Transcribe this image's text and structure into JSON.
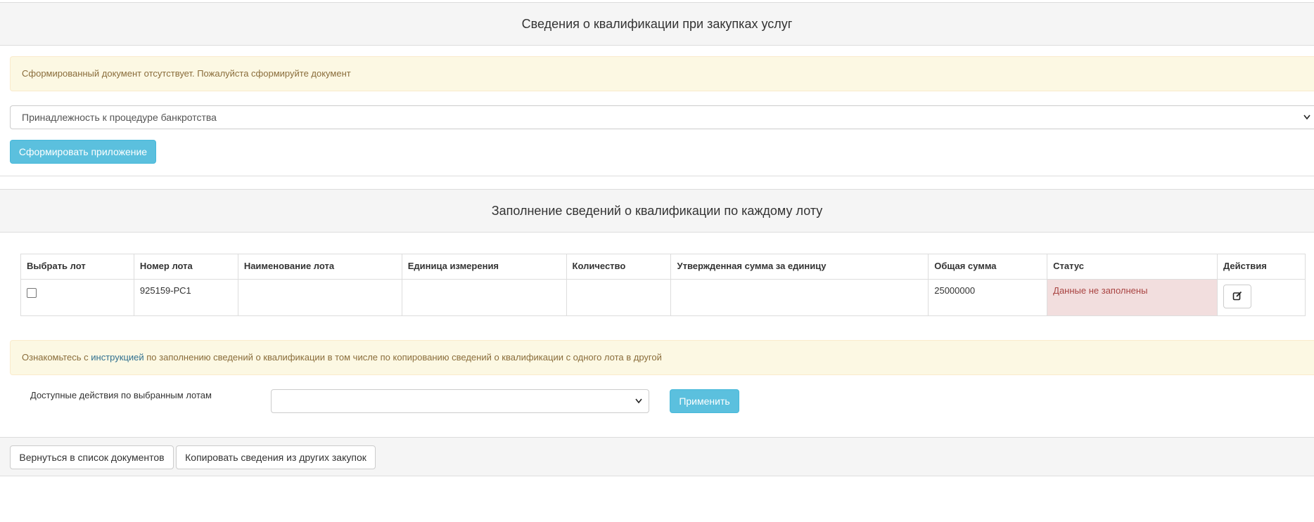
{
  "section_qualification": {
    "title": "Сведения о квалификации при закупках услуг",
    "alert_text": "Сформированный документ отсутствует. Пожалуйста сформируйте документ",
    "bankruptcy_select_value": "Принадлежность к процедуре банкротства",
    "generate_button": "Сформировать приложение"
  },
  "section_lots": {
    "title": "Заполнение сведений о квалификации по каждому лоту",
    "table": {
      "headers": [
        "Выбрать лот",
        "Номер лота",
        "Наименование лота",
        "Единица измерения",
        "Количество",
        "Утвержденная сумма за единицу",
        "Общая сумма",
        "Статус",
        "Действия"
      ],
      "rows": [
        {
          "selected": false,
          "lot_number": "925159-РС1",
          "lot_name": "",
          "unit": "",
          "quantity": "",
          "unit_price": "",
          "total": "25000000",
          "status": "Данные не заполнены",
          "status_color": "#f2dede",
          "action_icon": "edit-icon"
        }
      ]
    },
    "instruction_alert": {
      "prefix": "Ознакомьтесь с ",
      "link": "инструкцией",
      "suffix": " по заполнению сведений о квалификации в том числе по копированию сведений о квалификации с одного лота в другой"
    },
    "actions_label": "Доступные действия по выбранным лотам",
    "actions_select_value": "",
    "apply_button": "Применить"
  },
  "footer": {
    "back_button": "Вернуться в список документов",
    "copy_button": "Копировать сведения из других закупок"
  },
  "colors": {
    "info_button": "#5bc0de",
    "warning_alert_bg": "#fcf8e3",
    "warning_alert_text": "#8a6d3b",
    "danger_cell_bg": "#f2dede",
    "link": "#31708f"
  }
}
